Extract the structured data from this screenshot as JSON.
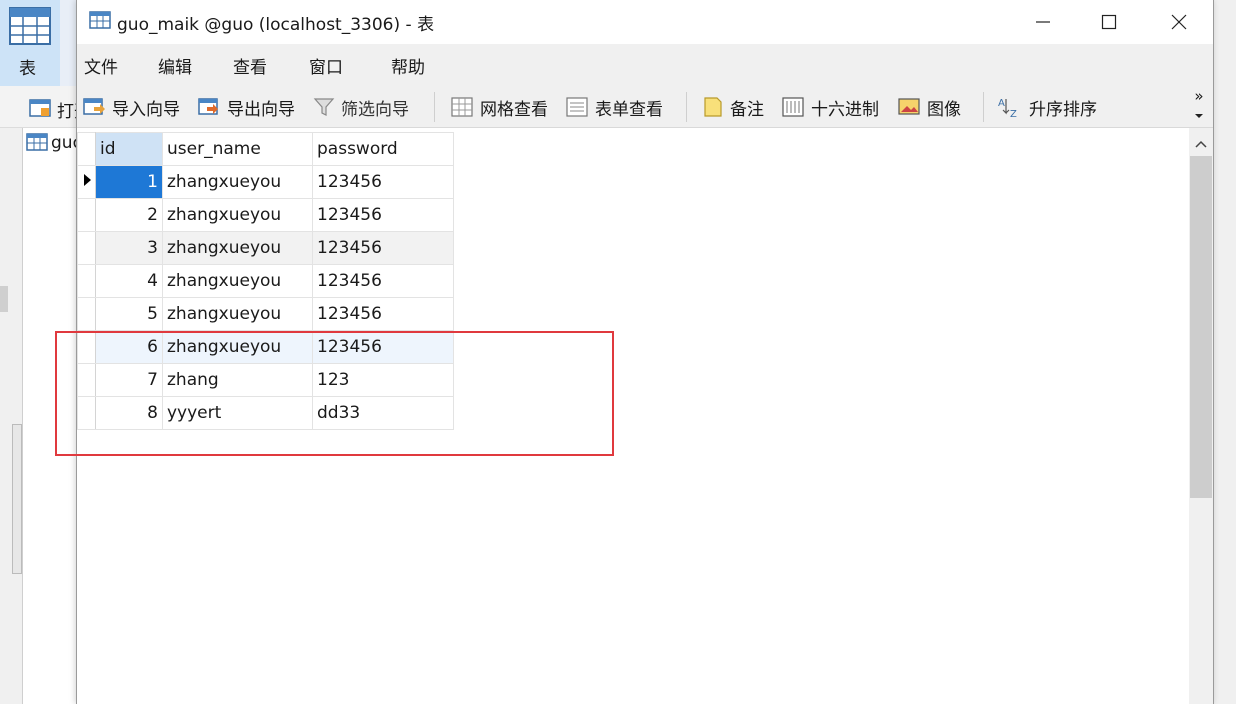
{
  "background_app": {
    "table_button_label": "表",
    "open_table_label": "打开表",
    "tree_item_label": "guo"
  },
  "window": {
    "title": "guo_maik @guo (localhost_3306) - 表"
  },
  "menu": [
    "文件",
    "编辑",
    "查看",
    "窗口",
    "帮助"
  ],
  "toolbar": {
    "import_wizard": "导入向导",
    "export_wizard": "导出向导",
    "filter_wizard": "筛选向导",
    "grid_view": "网格查看",
    "form_view": "表单查看",
    "memo": "备注",
    "hex": "十六进制",
    "image": "图像",
    "sort_asc": "升序排序",
    "more": "»"
  },
  "grid": {
    "columns": [
      "id",
      "user_name",
      "password"
    ],
    "rows": [
      {
        "id": "1",
        "user_name": "zhangxueyou",
        "password": "123456"
      },
      {
        "id": "2",
        "user_name": "zhangxueyou",
        "password": "123456"
      },
      {
        "id": "3",
        "user_name": "zhangxueyou",
        "password": "123456"
      },
      {
        "id": "4",
        "user_name": "zhangxueyou",
        "password": "123456"
      },
      {
        "id": "5",
        "user_name": "zhangxueyou",
        "password": "123456"
      },
      {
        "id": "6",
        "user_name": "zhangxueyou",
        "password": "123456"
      },
      {
        "id": "7",
        "user_name": "zhang",
        "password": "123"
      },
      {
        "id": "8",
        "user_name": "yyyert",
        "password": "dd33"
      }
    ],
    "selected_row": 1
  },
  "colors": {
    "selection": "#1e78d6",
    "annotation": "#e0393e",
    "header_highlight": "#cfe2f5"
  }
}
